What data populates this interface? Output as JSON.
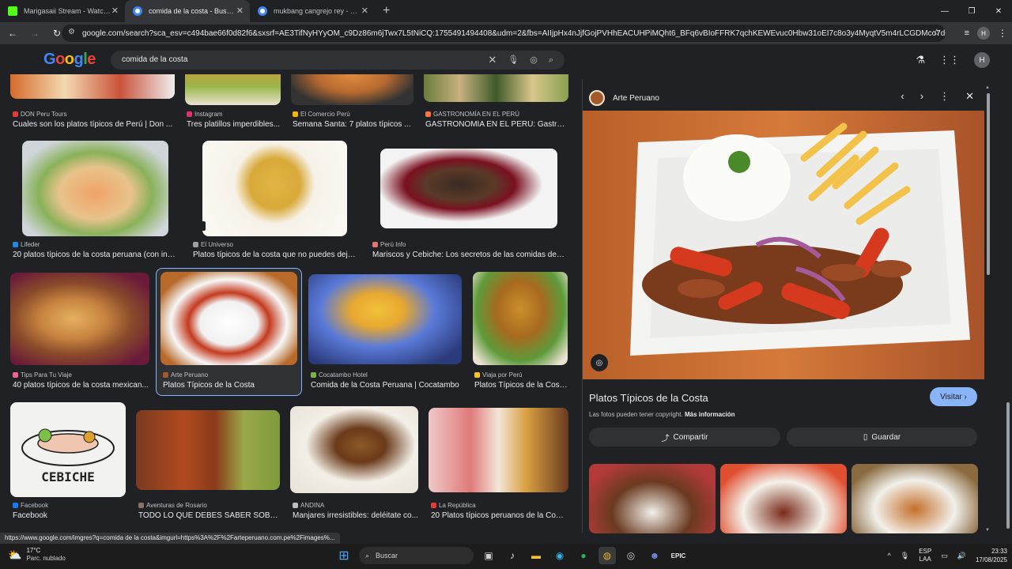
{
  "browser": {
    "tabs": [
      {
        "title": "Marigasaii Stream - Watch Live",
        "fav_color": "#53fc18"
      },
      {
        "title": "comida de la costa - Buscar con Google",
        "fav_color": "#e8eaed"
      },
      {
        "title": "mukbang cangrejo rey - Buscar con Google",
        "fav_color": "#e8eaed"
      }
    ],
    "new_tab": "+",
    "url": "google.com/search?sca_esv=c494bae66f0d82f6&sxsrf=AE3TifNyHYyOM_c9Dz86m6jTwx7L5tNiCQ:1755491494408&udm=2&fbs=AIIjpHx4nJjfGojPVHhEACUHPiMQht6_BFq6vBIoFFRK7qchKEWEvuc0Hbw31oEI7c8o3y4MyqtV5m4rLCGDMco7dQbsn3LCPjOfwb3...",
    "profile_initial": "H"
  },
  "google": {
    "logo": "Google",
    "query": "comida de la costa",
    "avatar_initial": "H"
  },
  "results": [
    {
      "source": "DON Peru Tours",
      "caption": "Cuales son los platos típicos de Perú | Don ...",
      "src_color": "#e53935"
    },
    {
      "source": "Instagram",
      "caption": "Tres platillos imperdibles...",
      "src_color": "#e1306c"
    },
    {
      "source": "El Comercio Perú",
      "caption": "Semana Santa: 7 platos típicos ...",
      "src_color": "#f4b400"
    },
    {
      "source": "GASTRONOMÍA EN EL PERÚ",
      "caption": "GASTRONOMÍA EN EL PERÚ: Gastro...",
      "src_color": "#ff7043"
    },
    {
      "source": "Lifeder",
      "caption": "20 platos típicos de la costa peruana (con ingr...",
      "src_color": "#1e88e5"
    },
    {
      "source": "El Universo",
      "caption": "Platos típicos de la costa que no puedes dejar...",
      "src_color": "#9e9e9e"
    },
    {
      "source": "Perú Info",
      "caption": "Mariscos y Cebiche: Los secretos de las comidas de la...",
      "src_color": "#e57373"
    },
    {
      "source": "Tips Para Tu Viaje",
      "caption": "40 platos típicos de la costa mexican...",
      "src_color": "#f06292"
    },
    {
      "source": "Arte Peruano",
      "caption": "Platos Típicos de la Costa",
      "src_color": "#a05a2c"
    },
    {
      "source": "Cocatambo Hotel",
      "caption": "Comida de la Costa Peruana | Cocatambo",
      "src_color": "#7cb342"
    },
    {
      "source": "Viaja por Perú",
      "caption": "Platos Típicos de la Cost...",
      "src_color": "#fbc02d"
    },
    {
      "source": "Facebook",
      "caption": "Facebook",
      "src_color": "#1877f2"
    },
    {
      "source": "Aventuras de Rosario",
      "caption": "TODO LO QUE DEBES SABER SOBR...",
      "src_color": "#8d6e63"
    },
    {
      "source": "ANDINA",
      "caption": "Manjares irresistibles: deléitate co...",
      "src_color": "#bdbdbd"
    },
    {
      "source": "La República",
      "caption": "20 Platos típicos peruanos de la Cost...",
      "src_color": "#e53935"
    }
  ],
  "panel": {
    "source": "Arte Peruano",
    "title": "Platos Típicos de la Costa",
    "visit": "Visitar",
    "copyright": "Las fotos pueden tener copyright.",
    "more_info": "Más información",
    "share": "Compartir",
    "save": "Guardar"
  },
  "status_url": "https://www.google.com/imgres?q=comida de la costa&imgurl=https%3A%2F%2Farteperuano.com.pe%2Fimages%...",
  "taskbar": {
    "temp": "17°C",
    "weather": "Parc. nublado",
    "search": "Buscar",
    "lang1": "ESP",
    "lang2": "LAA",
    "time": "23:33",
    "date": "17/08/2025"
  }
}
